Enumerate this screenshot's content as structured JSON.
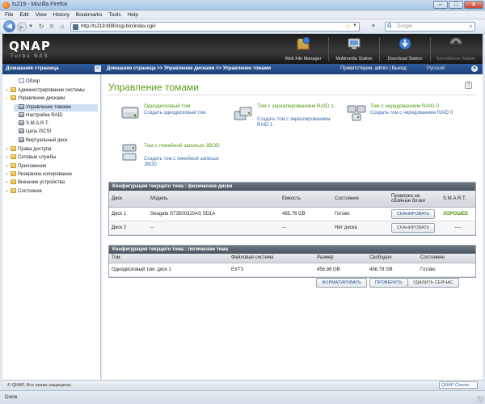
{
  "window": {
    "title": "ts219 - Mozilla Firefox",
    "minimize": "–",
    "maximize": "□",
    "close": "x"
  },
  "menu": [
    "File",
    "Edit",
    "View",
    "History",
    "Bookmarks",
    "Tools",
    "Help"
  ],
  "nav": {
    "url": "http://ts219:8080/cgi-bin/index.cgi#",
    "search_placeholder": "Google"
  },
  "brand": {
    "logo": "QNAP",
    "subtitle": "Turbo NAS"
  },
  "header_apps": [
    {
      "label": "Web File Manager",
      "icon": "web-file-manager-icon"
    },
    {
      "label": "Multimedia Station",
      "icon": "multimedia-station-icon"
    },
    {
      "label": "Download Station",
      "icon": "download-station-icon"
    },
    {
      "label": "Surveillance Station",
      "icon": "surveillance-station-icon"
    }
  ],
  "bluebar": {
    "home": "Домашняя страница",
    "collapse": "«",
    "breadcrumb": "Домашняя страница >> Управление дисками >> Управление томами",
    "welcome": "Приветствуем, admin | Выход",
    "language": "Русский"
  },
  "sidebar": [
    {
      "label": "Обзор",
      "icon": "page",
      "toggle": "",
      "level": 1
    },
    {
      "label": "Администрирование системы",
      "icon": "folder",
      "toggle": "+",
      "level": 0
    },
    {
      "label": "Управление дисками",
      "icon": "folder",
      "toggle": "−",
      "level": 0
    },
    {
      "label": "Управление томами",
      "icon": "disk",
      "toggle": "",
      "level": 1,
      "selected": true
    },
    {
      "label": "Настройка RAID",
      "icon": "disk",
      "toggle": "",
      "level": 1
    },
    {
      "label": "S.M.A.R.T.",
      "icon": "disk",
      "toggle": "",
      "level": 1
    },
    {
      "label": "Цель iSCSI",
      "icon": "disk",
      "toggle": "",
      "level": 1
    },
    {
      "label": "Виртуальный диск",
      "icon": "disk",
      "toggle": "",
      "level": 1
    },
    {
      "label": "Права доступа",
      "icon": "folder",
      "toggle": "+",
      "level": 0
    },
    {
      "label": "Сетевые службы",
      "icon": "folder",
      "toggle": "+",
      "level": 0
    },
    {
      "label": "Приложения",
      "icon": "folder",
      "toggle": "+",
      "level": 0
    },
    {
      "label": "Резервное копирование",
      "icon": "folder",
      "toggle": "+",
      "level": 0
    },
    {
      "label": "Внешние устройства",
      "icon": "folder",
      "toggle": "+",
      "level": 0
    },
    {
      "label": "Состояние",
      "icon": "folder",
      "toggle": "+",
      "level": 0
    }
  ],
  "main": {
    "title": "Управление томами",
    "help": "?",
    "volume_types": [
      {
        "title": "Однодисковый том",
        "link": "Создать однодисковый том"
      },
      {
        "title": "Том с зеркалированием RAID 1",
        "link": "Создать том с зеркалированием RAID 1"
      },
      {
        "title": "Том с чередованием RAID 0",
        "link": "Создать том с чередованием RAID 0"
      },
      {
        "title": "Том с линейной записью JBOD",
        "link": "Создать том с линейной записью JBOD"
      }
    ],
    "physical": {
      "header": "Конфигурация текущего тома : физические диски",
      "columns": [
        "Диск",
        "Модель",
        "Емкость",
        "Состояние",
        "Проверка на сбойные блоки",
        "S.M.A.R.T."
      ],
      "rows": [
        {
          "disk": "Диск 1",
          "model": "Seagate ST3500320AS SD1A",
          "capacity": "465.76 GB",
          "status": "Готово",
          "scan": "СКАНИРОВАТЬ",
          "smart": "ХОРОШЕЕ"
        },
        {
          "disk": "Диск 2",
          "model": "--",
          "capacity": "--",
          "status": "Нет диска",
          "scan": "СКАНИРОВАТЬ",
          "smart": "----"
        }
      ]
    },
    "logical": {
      "header": "Конфигурация текущего тома : логические тома",
      "columns": [
        "Том",
        "Файловая система",
        "Размер",
        "Свободно",
        "Состояние"
      ],
      "rows": [
        {
          "volume": "Однодисковый том: диск 1",
          "fs": "EXT3",
          "size": "456.98 GB",
          "free": "456.79 GB",
          "status": "Готово"
        }
      ],
      "actions": [
        "ФОРМАТИРОВАТЬ",
        "ПРОВЕРИТЬ",
        "УДАЛИТЬ СЕЙЧАС"
      ]
    }
  },
  "footer": {
    "copyright": "© QNAP, Все права защищены",
    "theme": "QNAP Classic"
  },
  "status": "Done",
  "colors": {
    "accent_green": "#5a9b17",
    "link_blue": "#3a67a8",
    "nav_blue": "#1e4279"
  }
}
